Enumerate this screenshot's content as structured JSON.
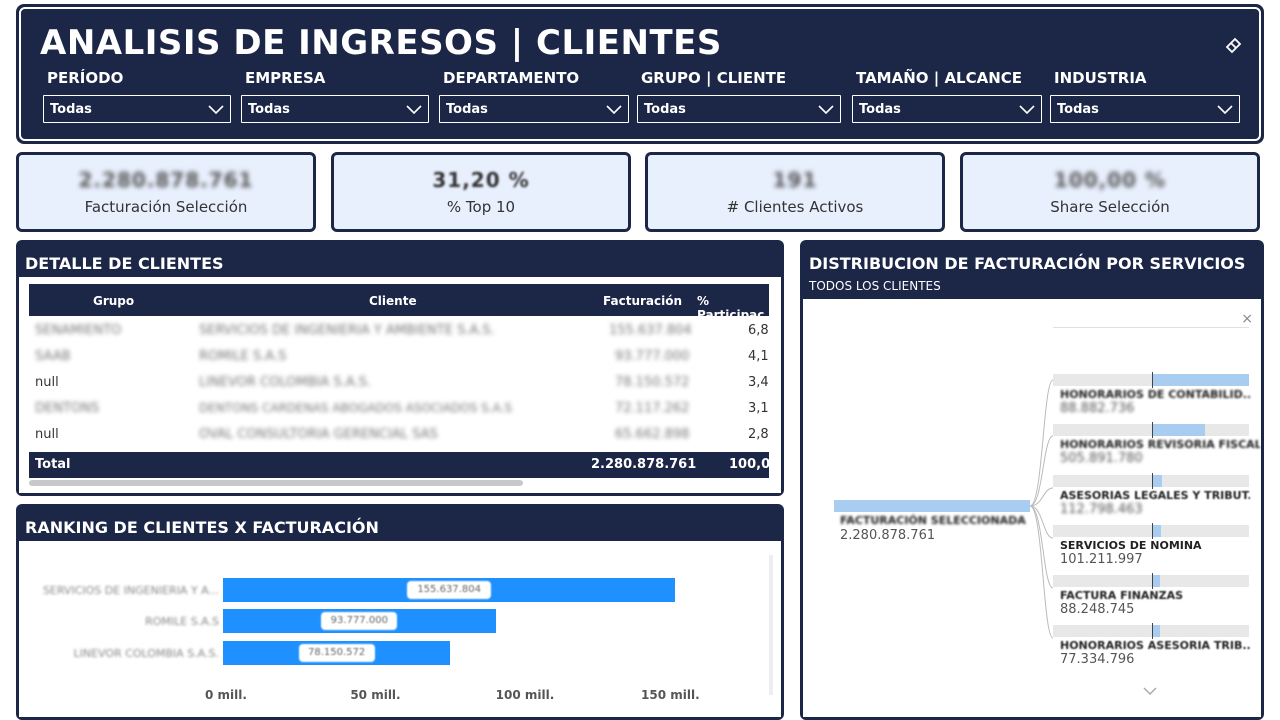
{
  "header": {
    "title": "ANALISIS DE INGRESOS | CLIENTES",
    "filters": [
      {
        "label": "PERÍODO",
        "value": "Todas"
      },
      {
        "label": "EMPRESA",
        "value": "Todas"
      },
      {
        "label": "DEPARTAMENTO",
        "value": "Todas"
      },
      {
        "label": "GRUPO | CLIENTE",
        "value": "Todas"
      },
      {
        "label": "TAMAÑO | ALCANCE",
        "value": "Todas"
      },
      {
        "label": "INDUSTRIA",
        "value": "Todas"
      }
    ]
  },
  "kpis": [
    {
      "value": "2.280.878.761",
      "label": "Facturación Selección"
    },
    {
      "value": "31,20 %",
      "label": "% Top 10"
    },
    {
      "value": "191",
      "label": "# Clientes Activos"
    },
    {
      "value": "100,00 %",
      "label": "Share Selección"
    }
  ],
  "detalle": {
    "title": "DETALLE DE CLIENTES",
    "columns": [
      "Grupo",
      "Cliente",
      "Facturación",
      "% Participac"
    ],
    "rows": [
      {
        "grupo": "SENAMIENTO",
        "cliente": "SERVICIOS DE INGENIERIA Y AMBIENTE S.A.S.",
        "facturacion": "155.637.804",
        "pct": "6,8"
      },
      {
        "grupo": "SAAB",
        "cliente": "ROMILE S.A.S",
        "facturacion": "93.777.000",
        "pct": "4,1"
      },
      {
        "grupo": "null",
        "cliente": "LINEVOR COLOMBIA S.A.S.",
        "facturacion": "78.150.572",
        "pct": "3,4"
      },
      {
        "grupo": "DENTONS",
        "cliente": "DENTONS CARDENAS ABOGADOS ASOCIADOS S.A.S",
        "facturacion": "72.117.262",
        "pct": "3,1"
      },
      {
        "grupo": "null",
        "cliente": "OVAL CONSULTORIA GERENCIAL SAS",
        "facturacion": "65.662.898",
        "pct": "2,8"
      }
    ],
    "total_label": "Total",
    "total_value": "2.280.878.761",
    "total_pct": "100,0"
  },
  "ranking": {
    "title": "RANKING DE CLIENTES X FACTURACIÓN",
    "ticks": [
      "0 mill.",
      "50 mill.",
      "100 mill.",
      "150 mill."
    ],
    "xlim": [
      0,
      160
    ],
    "bars": [
      {
        "name": "SERVICIOS DE INGENIERIA Y A...",
        "value": 155.6,
        "label": "155.637.804"
      },
      {
        "name": "ROMILE S.A.S",
        "value": 93.8,
        "label": "93.777.000"
      },
      {
        "name": "LINEVOR COLOMBIA S.A.S.",
        "value": 78.2,
        "label": "78.150.572"
      }
    ]
  },
  "chart_data": {
    "type": "bar",
    "orientation": "horizontal",
    "categories": [
      "SERVICIOS DE INGENIERIA Y A...",
      "ROMILE S.A.S",
      "LINEVOR COLOMBIA S.A.S."
    ],
    "values": [
      155.6,
      93.8,
      78.2
    ],
    "xlim": [
      0,
      160
    ],
    "xticks": [
      "0 mill.",
      "50 mill.",
      "100 mill.",
      "150 mill."
    ]
  },
  "distribucion": {
    "title": "DISTRIBUCION DE FACTURACIÓN POR SERVICIOS",
    "subtitle": "TODOS LOS CLIENTES",
    "root": {
      "name": "FACTURACIÓN SELECCIONADA",
      "value": "2.280.878.761"
    },
    "nodes": [
      {
        "name": "HONORARIOS DE CONTABILID...",
        "value": "88.882.736",
        "share": 1.0
      },
      {
        "name": "HONORARIOS REVISORIA FISCAL",
        "value": "505.891.780",
        "share": 0.55
      },
      {
        "name": "ASESORIAS LEGALES Y TRIBUT...",
        "value": "112.798.463",
        "share": 0.1
      },
      {
        "name": "SERVICIOS DE NOMINA",
        "value": "101.211.997",
        "share": 0.09
      },
      {
        "name": "FACTURA FINANZAS",
        "value": "88.248.745",
        "share": 0.08
      },
      {
        "name": "HONORARIOS ASESORIA TRIB...",
        "value": "77.334.796",
        "share": 0.07
      }
    ]
  },
  "colors": {
    "navy": "#1c2747",
    "bar": "#1e90ff",
    "kpi_bg": "#e8effd",
    "node_bar": "#a8cdf0"
  }
}
